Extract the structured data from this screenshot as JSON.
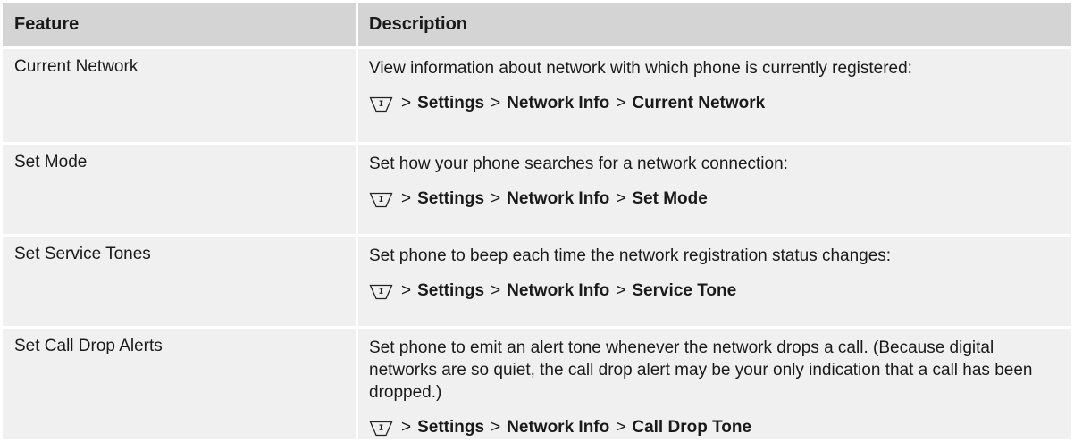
{
  "table": {
    "header": {
      "feature": "Feature",
      "description": "Description"
    },
    "rows": [
      {
        "feature": "Current Network",
        "description": "View information about network with which phone is currently registered:",
        "path": {
          "sep": ">",
          "p1": "Settings",
          "p2": "Network Info",
          "p3": "Current Network"
        }
      },
      {
        "feature": "Set Mode",
        "description": "Set how your phone searches for a network connection:",
        "path": {
          "sep": ">",
          "p1": "Settings",
          "p2": "Network Info",
          "p3": "Set Mode"
        }
      },
      {
        "feature": "Set Service Tones",
        "description": "Set phone to beep each time the network registration status changes:",
        "path": {
          "sep": ">",
          "p1": "Settings",
          "p2": "Network Info",
          "p3": "Service Tone"
        }
      },
      {
        "feature": "Set Call Drop Alerts",
        "description": "Set phone to emit an alert tone whenever the network drops a call. (Because digital networks are so quiet, the call drop alert may be your only indication that a call has been dropped.)",
        "path": {
          "sep": ">",
          "p1": "Settings",
          "p2": "Network Info",
          "p3": "Call Drop Tone"
        }
      }
    ]
  },
  "icons": {
    "menu_key": "menu-key-icon"
  },
  "colors": {
    "header_bg": "#d4d4d4",
    "row_bg": "#f0f0f0"
  }
}
